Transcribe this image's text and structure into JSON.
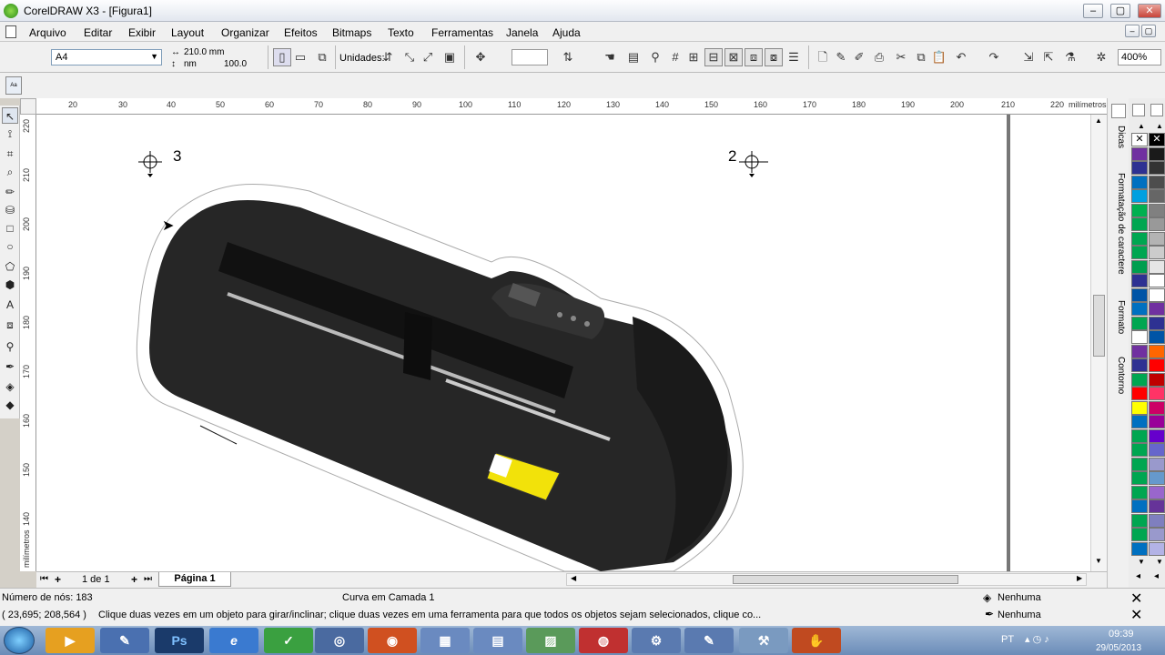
{
  "window": {
    "title": "CorelDRAW X3 - [Figura1]"
  },
  "menu": {
    "items": [
      "Arquivo",
      "Editar",
      "Exibir",
      "Layout",
      "Organizar",
      "Efeitos",
      "Bitmaps",
      "Texto",
      "Ferramentas",
      "Janela",
      "Ajuda"
    ]
  },
  "propbar": {
    "paper_size": "A4",
    "width": "210.0 mm",
    "height_unit": "nm",
    "height_value": "100.0",
    "units_label": "Unidades:",
    "zoom": "400%"
  },
  "rulers": {
    "h_ticks": [
      "20",
      "30",
      "40",
      "50",
      "60",
      "70",
      "80",
      "90",
      "100",
      "110",
      "120",
      "130",
      "140",
      "150",
      "160",
      "170",
      "180",
      "190",
      "200",
      "210",
      "220"
    ],
    "h_unit": "milímetros",
    "v_ticks": [
      "220",
      "210",
      "200",
      "190",
      "180",
      "170",
      "160",
      "150",
      "140"
    ],
    "v_unit": "milímetros"
  },
  "canvas": {
    "registration_marks": [
      {
        "label": "3"
      },
      {
        "label": "2"
      }
    ]
  },
  "dock": {
    "tabs": [
      "Dicas",
      "Formatação de caractere",
      "Formato",
      "Contorno"
    ]
  },
  "palette": {
    "col1": [
      "#ffffff",
      "#7030a0",
      "#2e3192",
      "#0070c0",
      "#00a0e0",
      "#00b050",
      "#00a651",
      "#00a651",
      "#00a651",
      "#009e4f",
      "#2e3192",
      "#0054a6",
      "#0070c0",
      "#00a651",
      "#ffffff",
      "#7030a0",
      "#2e3192",
      "#00a651",
      "#ff0000",
      "#ffff00",
      "#0070c0",
      "#00a651",
      "#00a651",
      "#00a651",
      "#00a651",
      "#00a651",
      "#0070c0",
      "#00a651",
      "#00a651",
      "#0070c0"
    ],
    "col2": [
      "#000000",
      "#1a1a1a",
      "#333333",
      "#4d4d4d",
      "#666666",
      "#808080",
      "#999999",
      "#b3b3b3",
      "#cccccc",
      "#e6e6e6",
      "#ffffff",
      "#ffffff",
      "#7030a0",
      "#2e3192",
      "#0054a6",
      "#ff6600",
      "#ff0000",
      "#c00000",
      "#ff3366",
      "#cc0066",
      "#990099",
      "#6600cc",
      "#6666cc",
      "#9999cc",
      "#6699cc",
      "#9966cc",
      "#663399",
      "#7f7fbf",
      "#9999cc",
      "#b3b3e6"
    ]
  },
  "pagebar": {
    "page_count": "1 de 1",
    "page_tab": "Página 1"
  },
  "status": {
    "nodes": "Número de nós: 183",
    "layer": "Curva em Camada 1",
    "coords": "( 23,695; 208,564 )",
    "hint": "Clique duas vezes em um objeto para girar/inclinar; clique duas vezes em uma ferramenta para que todos os objetos sejam selecionados, clique co...",
    "fill": "Nenhuma",
    "outline": "Nenhuma"
  },
  "taskbar": {
    "apps": [
      "",
      "",
      "Ps",
      "e",
      "",
      "",
      "",
      "",
      "",
      "",
      "",
      "",
      "",
      "",
      "",
      ""
    ],
    "lang": "PT",
    "time": "09:39",
    "date": "29/05/2013"
  }
}
